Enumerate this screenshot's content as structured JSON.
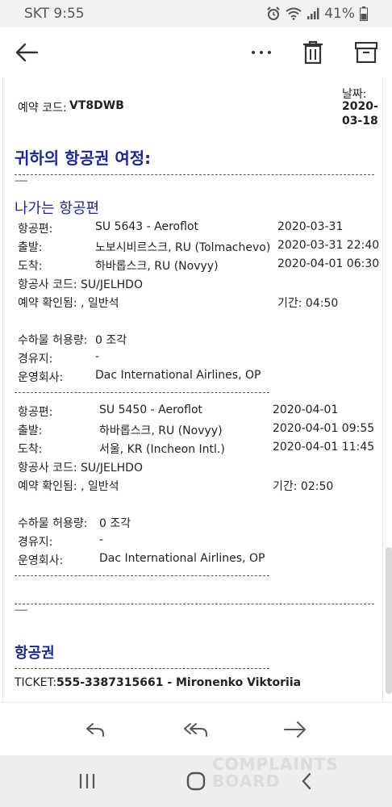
{
  "status_bar": {
    "carrier_time": "SKT 9:55",
    "battery": "41%"
  },
  "toolbar": {
    "back_icon": "arrow-left-icon",
    "more_icon": "more-dots-icon",
    "delete_icon": "trash-icon",
    "archive_icon": "archive-icon"
  },
  "email": {
    "booking_code_label": "예약 코드:",
    "booking_code": "VT8DWB",
    "date_label": "날짜:",
    "date_line1": "2020-",
    "date_line2": "03-18",
    "itinerary_title": "귀하의 항공권 여정:",
    "dash_tail": "------",
    "outbound_title": "나가는 항공편",
    "flights": [
      {
        "flight_label": "항공편:",
        "flight": "SU 5643 - Aeroflot",
        "flight_date": "2020-03-31",
        "dep_label": "출발:",
        "dep": "노보시비르스크, RU (Tolmachevo)",
        "dep_time": "2020-03-31 22:40",
        "arr_label": "도착:",
        "arr": "하바롭스크, RU (Novyy)",
        "arr_time": "2020-04-01 06:30",
        "airline_code": "항공사 코드: SU/JELHDO",
        "confirmed": "예약 확인됨: , 일반석",
        "duration": "기간: 04:50",
        "baggage_label": "수하물 허용량:",
        "baggage": "0 조각",
        "via_label": "경유지:",
        "via": "-",
        "operator_label": "운영회사:",
        "operator": "Dac International Airlines, OP"
      },
      {
        "flight_label": "항공편:",
        "flight": "SU 5450 - Aeroflot",
        "flight_date": "2020-04-01",
        "dep_label": "출발:",
        "dep": "하바롭스크, RU (Novyy)",
        "dep_time": "2020-04-01 09:55",
        "arr_label": "도착:",
        "arr": "서울, KR (Incheon Intl.)",
        "arr_time": "2020-04-01 11:45",
        "airline_code": "항공사 코드: SU/JELHDO",
        "confirmed": "예약 확인됨: , 일반석",
        "duration": "기간: 02:50",
        "baggage_label": "수하물 허용량:",
        "baggage": "0 조각",
        "via_label": "경유지:",
        "via": "-",
        "operator_label": "운영회사:",
        "operator": "Dac International Airlines, OP"
      }
    ],
    "ticket_title": "항공권",
    "ticket_label": "TICKET:",
    "ticket_value": "555-3387315661 - Mironenko Viktoriia"
  },
  "bottom_actions": {
    "reply_icon": "reply-icon",
    "reply_all_icon": "reply-all-icon",
    "forward_icon": "forward-icon"
  },
  "system_nav": {
    "recents_icon": "recents-icon",
    "home_icon": "home-icon",
    "back_icon": "back-chevron-icon"
  },
  "watermark": {
    "line1": "COMPLAINTS",
    "line2": "BOARD"
  },
  "colors": {
    "heading": "#1d2a8a",
    "status_bar_bg": "#f2f2f2",
    "nav_bar_bg": "#eeeeee"
  }
}
